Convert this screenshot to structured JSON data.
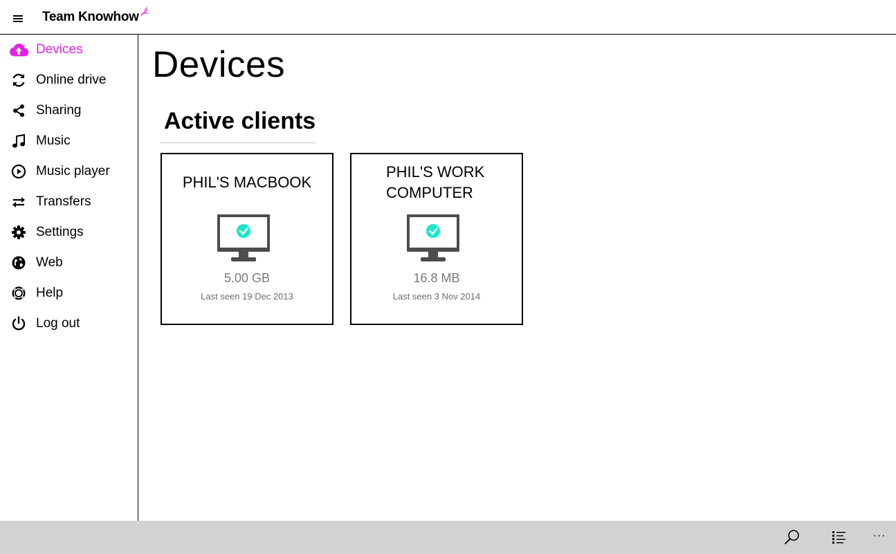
{
  "app": {
    "logo_text": "Team Knowhow"
  },
  "accent_color": "#e321e4",
  "status_color": "#19e8c8",
  "sidebar": {
    "items": [
      {
        "label": "Devices",
        "icon": "cloud-upload-icon",
        "active": true
      },
      {
        "label": "Online drive",
        "icon": "sync-icon"
      },
      {
        "label": "Sharing",
        "icon": "share-icon"
      },
      {
        "label": "Music",
        "icon": "music-note-icon"
      },
      {
        "label": "Music player",
        "icon": "play-circle-icon"
      },
      {
        "label": "Transfers",
        "icon": "transfer-arrows-icon"
      },
      {
        "label": "Settings",
        "icon": "gear-icon"
      },
      {
        "label": "Web",
        "icon": "globe-icon"
      },
      {
        "label": "Help",
        "icon": "lifebuoy-icon"
      },
      {
        "label": "Log out",
        "icon": "power-icon"
      }
    ]
  },
  "main": {
    "title": "Devices",
    "section_title": "Active clients",
    "devices": [
      {
        "name": "PHIL'S MACBOOK",
        "size": "5.00 GB",
        "last_seen": "Last seen 19 Dec 2013",
        "icon": "monitor-check-icon"
      },
      {
        "name": "PHIL'S WORK COMPUTER",
        "size": "16.8 MB",
        "last_seen": "Last seen 3 Nov 2014",
        "icon": "monitor-check-icon"
      }
    ]
  },
  "appbar": {
    "buttons": [
      {
        "icon": "search-icon"
      },
      {
        "icon": "list-view-icon"
      },
      {
        "icon": "more-icon",
        "glyph": "···"
      }
    ]
  }
}
